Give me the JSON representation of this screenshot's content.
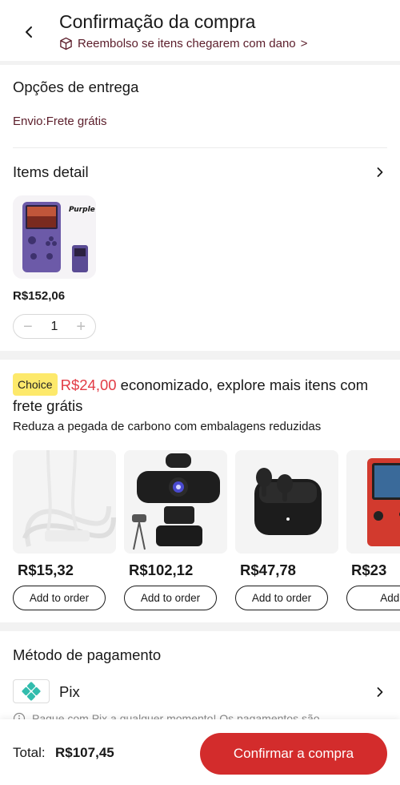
{
  "header": {
    "title": "Confirmação da compra",
    "subtitle": "Reembolso se itens chegarem com dano",
    "subtitle_chevron": ">"
  },
  "delivery": {
    "title": "Opções de entrega",
    "line": "Envio:Frete grátis"
  },
  "items": {
    "title": "Items detail",
    "product": {
      "variant_label": "Purple",
      "price": "R$152,06",
      "quantity": "1"
    }
  },
  "choice": {
    "badge": "Choice",
    "saved_amount": "R$24,00",
    "headline_rest": " economizado, explore mais itens com frete grátis",
    "carbon_note": "Reduza a pegada de carbono com embalagens reduzidas",
    "products": [
      {
        "price": "R$15,32",
        "button": "Add to order",
        "icon": "usb-cable"
      },
      {
        "price": "R$102,12",
        "button": "Add to order",
        "icon": "webcam"
      },
      {
        "price": "R$47,78",
        "button": "Add to order",
        "icon": "earbuds"
      },
      {
        "price": "R$23",
        "button": "Add t",
        "icon": "handheld-console"
      }
    ]
  },
  "payment": {
    "title": "Método de pagamento",
    "method": "Pix",
    "note": "Pague com Pix a qualquer momento! Os pagamentos são"
  },
  "footer": {
    "total_label": "Total:",
    "total_value": "R$107,45",
    "confirm_label": "Confirmar a compra"
  },
  "colors": {
    "accent": "#d32c2c",
    "saved": "#e23b45",
    "subtitle": "#5b1d2a",
    "choice_badge": "#fde96b",
    "pix": "#32bcad"
  }
}
